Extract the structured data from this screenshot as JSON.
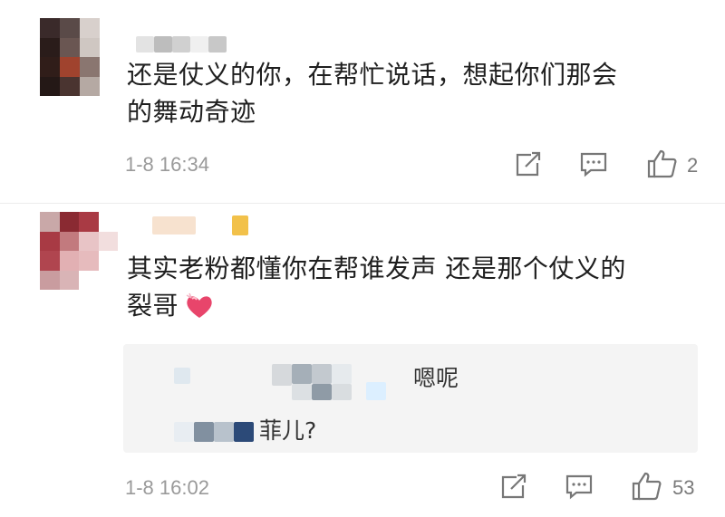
{
  "comments": [
    {
      "text_line1": "还是仗义的你，在帮忙说话，想起你们那会",
      "text_line2": "的舞动奇迹",
      "time": "1-8 16:34",
      "likes": "2"
    },
    {
      "text_line1": "其实老粉都懂你在帮谁发声 还是那个仗义的",
      "text_line2": "裂哥",
      "emoji": "heart-with-ribbon",
      "time": "1-8 16:02",
      "likes": "53",
      "replies": [
        {
          "text": "嗯呢"
        },
        {
          "text": "菲儿?"
        }
      ]
    }
  ],
  "icons": {
    "share": "share-icon",
    "comment": "comment-icon",
    "like": "thumbs-up-icon"
  },
  "colors": {
    "meta_text": "#9a9a9a",
    "heart": "#e8456b"
  }
}
